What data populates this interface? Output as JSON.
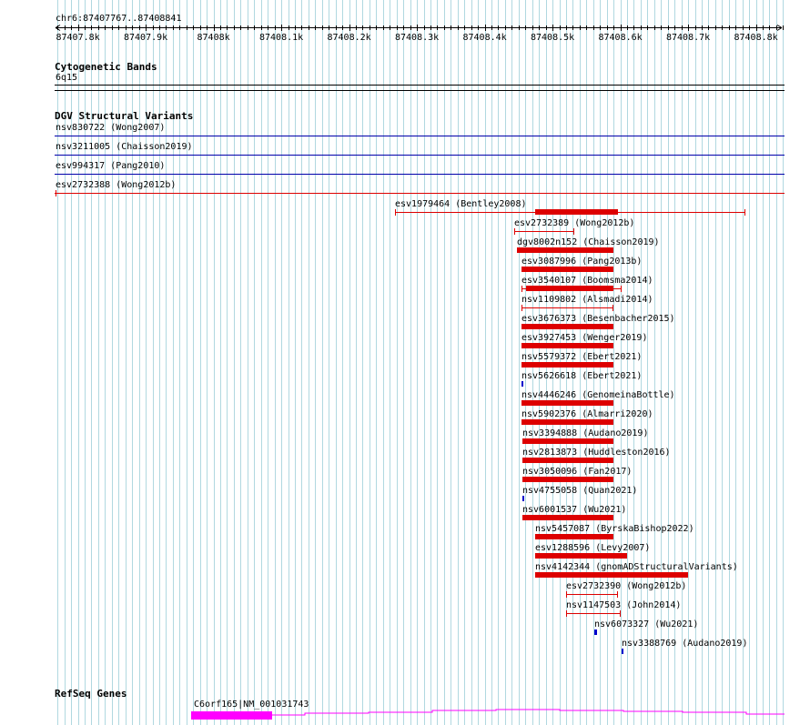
{
  "ruler": {
    "region_label": "chr6:87407767..87408841",
    "ticks": [
      {
        "label": "87407.8k",
        "bp": 87407800
      },
      {
        "label": "87407.9k",
        "bp": 87407900
      },
      {
        "label": "87408k",
        "bp": 87408000
      },
      {
        "label": "87408.1k",
        "bp": 87408100
      },
      {
        "label": "87408.2k",
        "bp": 87408200
      },
      {
        "label": "87408.3k",
        "bp": 87408300
      },
      {
        "label": "87408.4k",
        "bp": 87408400
      },
      {
        "label": "87408.5k",
        "bp": 87408500
      },
      {
        "label": "87408.6k",
        "bp": 87408600
      },
      {
        "label": "87408.7k",
        "bp": 87408700
      },
      {
        "label": "87408.8k",
        "bp": 87408800
      }
    ]
  },
  "cytobands": {
    "title": "Cytogenetic Bands",
    "band_label": "6q15"
  },
  "dgv": {
    "title": "DGV Structural Variants",
    "spanning": [
      {
        "label": "nsv830722 (Wong2007)",
        "color": "#0000aa"
      },
      {
        "label": "nsv3211005 (Chaisson2019)",
        "color": "#0000aa"
      },
      {
        "label": "esv994317 (Pang2010)",
        "color": "#0000aa"
      },
      {
        "label": "esv2732388 (Wong2012b)",
        "color": "#dd0000"
      }
    ],
    "features": [
      {
        "label": "esv1979464 (Bentley2008)",
        "color": "#dd0000",
        "start": 87408267,
        "end": 87408785,
        "thick_start": 87408475,
        "thick_end": 87408596,
        "caps": true
      },
      {
        "label": "esv2732389 (Wong2012b)",
        "color": "#dd0000",
        "start": 87408443,
        "end": 87408532,
        "caps": true
      },
      {
        "label": "dgv8002n152 (Chaisson2019)",
        "color": "#dd0000",
        "start": 87408448,
        "end": 87408590,
        "thick": true
      },
      {
        "label": "esv3087996 (Pang2013b)",
        "color": "#dd0000",
        "start": 87408454,
        "end": 87408590,
        "thick": true
      },
      {
        "label": "esv3540107 (Boomsma2014)",
        "color": "#dd0000",
        "start": 87408454,
        "end": 87408602,
        "thick_start": 87408461,
        "thick_end": 87408590,
        "caps": true
      },
      {
        "label": "nsv1109802 (Alsmadi2014)",
        "color": "#dd0000",
        "start": 87408454,
        "end": 87408590,
        "caps": true
      },
      {
        "label": "esv3676373 (Besenbacher2015)",
        "color": "#dd0000",
        "start": 87408454,
        "end": 87408590,
        "thick": true
      },
      {
        "label": "esv3927453 (Wenger2019)",
        "color": "#dd0000",
        "start": 87408454,
        "end": 87408590,
        "thick": true
      },
      {
        "label": "nsv5579372 (Ebert2021)",
        "color": "#dd0000",
        "start": 87408454,
        "end": 87408590,
        "thick": true
      },
      {
        "label": "nsv5626618 (Ebert2021)",
        "color": "#0000cc",
        "start": 87408454,
        "end": 87408457,
        "thick": true
      },
      {
        "label": "nsv4446246 (GenomeinaBottle)",
        "color": "#dd0000",
        "start": 87408454,
        "end": 87408590,
        "thick": true
      },
      {
        "label": "nsv5902376 (Almarri2020)",
        "color": "#dd0000",
        "start": 87408454,
        "end": 87408590,
        "thick": true
      },
      {
        "label": "nsv3394888 (Audano2019)",
        "color": "#dd0000",
        "start": 87408455,
        "end": 87408590,
        "thick": true
      },
      {
        "label": "nsv2813873 (Huddleston2016)",
        "color": "#dd0000",
        "start": 87408455,
        "end": 87408590,
        "thick": true
      },
      {
        "label": "nsv3050096 (Fan2017)",
        "color": "#dd0000",
        "start": 87408455,
        "end": 87408590,
        "thick": true
      },
      {
        "label": "nsv4755058 (Quan2021)",
        "color": "#0000cc",
        "start": 87408455,
        "end": 87408458,
        "thick": true
      },
      {
        "label": "nsv6001537 (Wu2021)",
        "color": "#dd0000",
        "start": 87408455,
        "end": 87408590,
        "thick": true
      },
      {
        "label": "nsv5457087 (ByrskaBishop2022)",
        "color": "#dd0000",
        "start": 87408475,
        "end": 87408590,
        "thick": true
      },
      {
        "label": "esv1288596 (Levy2007)",
        "color": "#dd0000",
        "start": 87408475,
        "end": 87408610,
        "thick": true
      },
      {
        "label": "nsv4142344 (gnomADStructuralVariants)",
        "color": "#dd0000",
        "start": 87408475,
        "end": 87408700,
        "thick": true
      },
      {
        "label": "esv2732390 (Wong2012b)",
        "color": "#dd0000",
        "start": 87408520,
        "end": 87408597,
        "caps": true
      },
      {
        "label": "nsv1147503 (John2014)",
        "color": "#dd0000",
        "start": 87408520,
        "end": 87408600,
        "caps": true
      },
      {
        "label": "nsv6073327 (Wu2021)",
        "color": "#0000cc",
        "start": 87408562,
        "end": 87408565,
        "thick": true
      },
      {
        "label": "nsv3388769 (Audano2019)",
        "color": "#0000cc",
        "start": 87408602,
        "end": 87408605,
        "thick": true
      }
    ]
  },
  "refseq": {
    "title": "RefSeq Genes",
    "gene_label": "C6orf165|NM_001031743",
    "color": "#ff00ff",
    "exon": {
      "start": 87407967,
      "end": 87408087
    }
  }
}
